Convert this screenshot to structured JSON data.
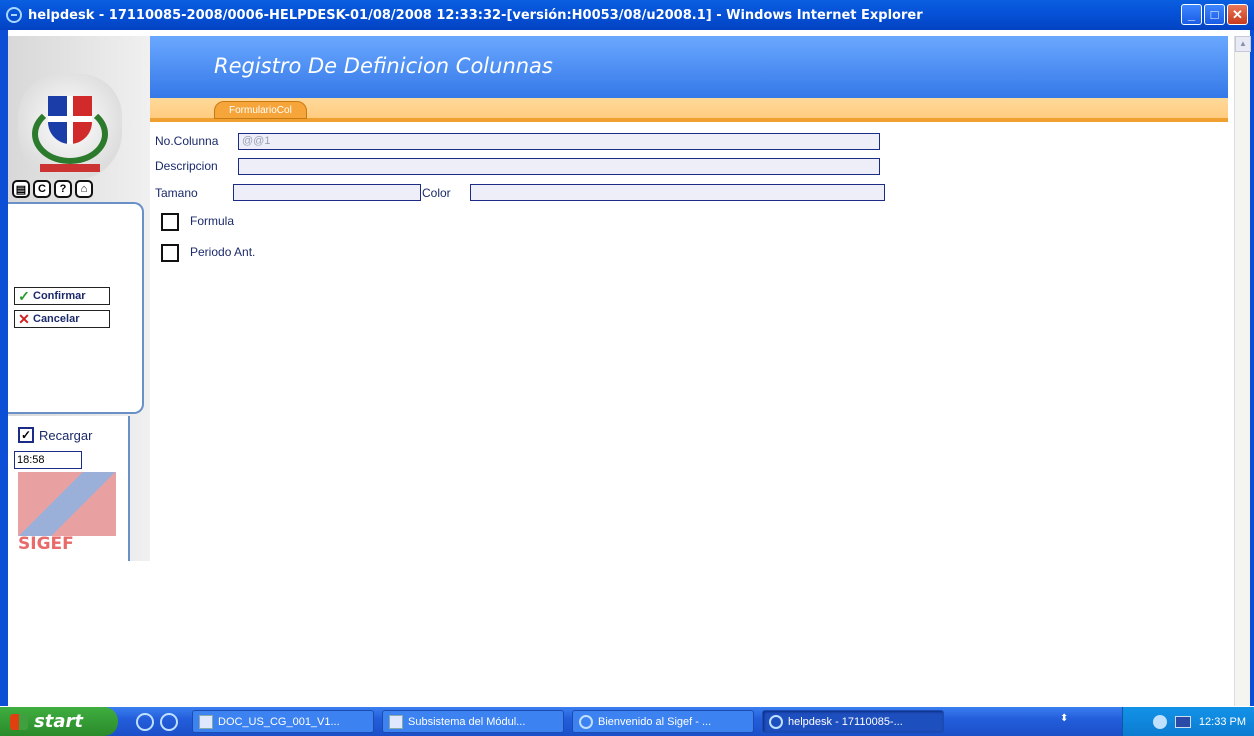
{
  "window": {
    "title": "helpdesk - 17110085-2008/0006-HELPDESK-01/08/2008 12:33:32-[versión:H0053/08/u2008.1] - Windows Internet Explorer",
    "controls": [
      "_",
      "□",
      "✕"
    ]
  },
  "header": {
    "title": "Registro De Definicion Colunnas",
    "tab_label": "FormularioCol"
  },
  "sidebar": {
    "icons": [
      "document-icon",
      "refresh-icon",
      "help-icon",
      "home-icon"
    ],
    "confirm_label": "Confirmar",
    "cancel_label": "Cancelar",
    "reload_label": "Recargar",
    "reload_checked": true,
    "time": "18:58",
    "logo_text": "SIGEF"
  },
  "form": {
    "no_columna_label": "No.Colunna",
    "no_columna_value": "@@1",
    "descripcion_label": "Descripcion",
    "descripcion_value": "",
    "tamano_label": "Tamano",
    "tamano_value": "",
    "color_label": "Color",
    "color_value": "",
    "formula_label": "Formula",
    "formula_checked": false,
    "periodo_label": "Periodo Ant.",
    "periodo_checked": false
  },
  "taskbar": {
    "start_label": "start",
    "buttons": [
      {
        "label": "DOC_US_CG_001_V1...",
        "icon": "word-icon",
        "active": false
      },
      {
        "label": "Subsistema del Módul...",
        "icon": "word-icon",
        "active": false
      },
      {
        "label": "Bienvenido al Sigef - ...",
        "icon": "ie-icon",
        "active": false
      },
      {
        "label": "helpdesk - 17110085-...",
        "icon": "ie-icon",
        "active": true
      }
    ],
    "clock": "12:33 PM"
  }
}
